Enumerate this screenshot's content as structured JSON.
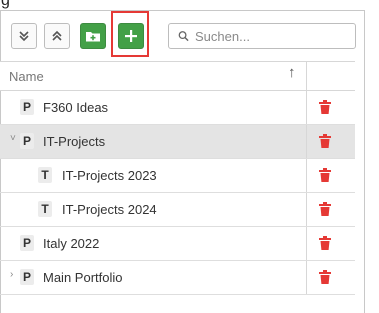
{
  "corner_glyph": "g",
  "toolbar": {
    "expand_all_icon": "double-chevron-down-icon",
    "collapse_all_icon": "double-chevron-up-icon",
    "new_folder_icon": "folder-plus-icon",
    "add_icon": "plus-icon",
    "add_label": "+",
    "search": {
      "placeholder": "Suchen...",
      "value": ""
    }
  },
  "grid": {
    "header_name": "Name",
    "sort_indicator": "↑",
    "rows": [
      {
        "badge": "P",
        "label": "F360 Ideas",
        "level": 0,
        "caret": "",
        "selected": false
      },
      {
        "badge": "P",
        "label": "IT-Projects",
        "level": 0,
        "caret": "˅",
        "selected": true
      },
      {
        "badge": "T",
        "label": "IT-Projects 2023",
        "level": 1,
        "caret": "",
        "selected": false
      },
      {
        "badge": "T",
        "label": "IT-Projects 2024",
        "level": 1,
        "caret": "",
        "selected": false
      },
      {
        "badge": "P",
        "label": "Italy 2022",
        "level": 0,
        "caret": "",
        "selected": false
      },
      {
        "badge": "P",
        "label": "Main Portfolio",
        "level": 0,
        "caret": "›",
        "selected": false
      }
    ]
  },
  "colors": {
    "accent_green": "#43a047",
    "delete_red": "#e53935",
    "selected_row": "#e4e4e4"
  }
}
